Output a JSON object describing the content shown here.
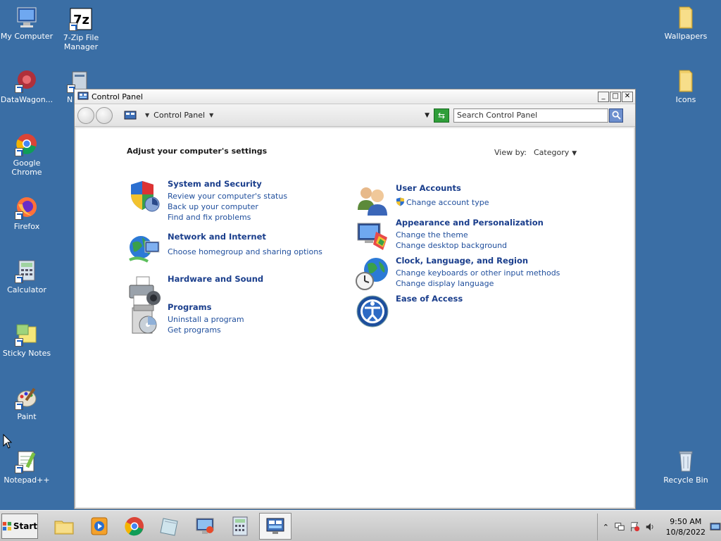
{
  "desktop": {
    "icons_left": [
      {
        "label": "My Computer"
      },
      {
        "label": "7-Zip File\nManager"
      },
      {
        "label": "DataWagon..."
      },
      {
        "label": "N"
      },
      {
        "label": "Google Chrome"
      },
      {
        "label": "Firefox"
      },
      {
        "label": "Calculator"
      },
      {
        "label": "Sticky Notes"
      },
      {
        "label": "Paint"
      },
      {
        "label": "Notepad++"
      }
    ],
    "icons_right": [
      {
        "label": "Wallpapers"
      },
      {
        "label": "Icons"
      },
      {
        "label": "Recycle Bin"
      }
    ]
  },
  "window": {
    "title": "Control Panel",
    "buttons": {
      "minimize": "_",
      "maximize": "□",
      "close": "✕"
    },
    "address": {
      "crumb": "Control Panel"
    },
    "search": {
      "value": "Search Control Panel"
    },
    "heading": "Adjust your computer's settings",
    "view_by": {
      "label": "View by:",
      "value": "Category"
    },
    "categories_left": [
      {
        "title": "System and Security",
        "links": [
          "Review your computer's status",
          "Back up your computer",
          "Find and fix problems"
        ]
      },
      {
        "title": "Network and Internet",
        "links": [
          "Choose homegroup and sharing options"
        ]
      },
      {
        "title": "Hardware and Sound",
        "links": []
      },
      {
        "title": "Programs",
        "links": [
          "Uninstall a program",
          "Get programs"
        ]
      }
    ],
    "categories_right": [
      {
        "title": "User Accounts",
        "links": [
          "Change account type"
        ]
      },
      {
        "title": "Appearance and Personalization",
        "links": [
          "Change the theme",
          "Change desktop background"
        ]
      },
      {
        "title": "Clock, Language, and Region",
        "links": [
          "Change keyboards or other input methods",
          "Change display language"
        ]
      },
      {
        "title": "Ease of Access",
        "links": []
      }
    ]
  },
  "taskbar": {
    "start_label": "Start",
    "clock_time": "9:50 AM",
    "clock_date": "10/8/2022"
  },
  "colors": {
    "desktop": "#3a6ea5",
    "link": "#1f4e9c",
    "category_title": "#1a3e8c"
  }
}
